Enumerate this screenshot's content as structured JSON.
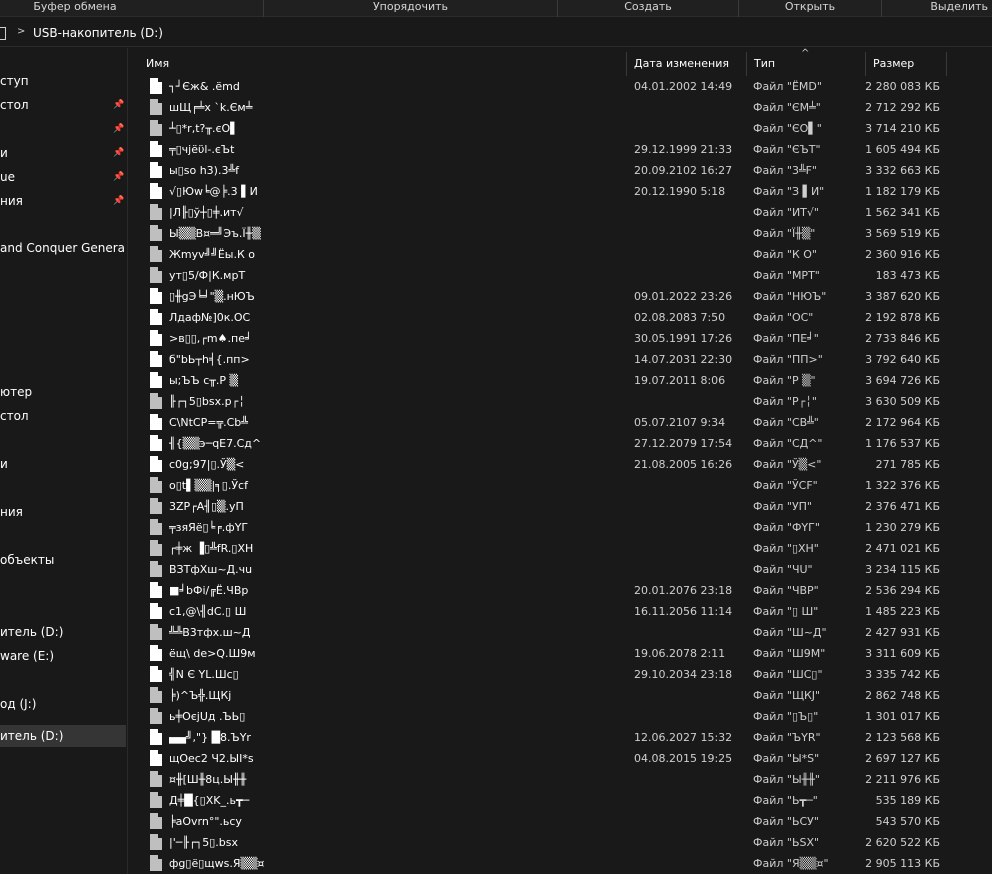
{
  "ribbon": {
    "groups": [
      "Буфер обмена",
      "Упорядочить",
      "Создать",
      "Открыть",
      "Выделить"
    ]
  },
  "address": {
    "path_label": "USB-накопитель (D:)"
  },
  "nav": {
    "items": [
      {
        "label": "ступ",
        "pinned": false
      },
      {
        "label": "стол",
        "pinned": true
      },
      {
        "label": "",
        "pinned": true
      },
      {
        "label": "и",
        "pinned": true
      },
      {
        "label": "ue",
        "pinned": true
      },
      {
        "label": "ния",
        "pinned": true
      },
      {
        "label": "and Conquer Generals Z",
        "pinned": false
      },
      {
        "label": "ютер",
        "pinned": false
      },
      {
        "label": "стол",
        "pinned": false
      },
      {
        "label": "",
        "pinned": false
      },
      {
        "label": "и",
        "pinned": false
      },
      {
        "label": "ния",
        "pinned": false
      },
      {
        "label": "объекты",
        "pinned": false
      },
      {
        "label": "итель (D:)",
        "pinned": false
      },
      {
        "label": "ware (E:)",
        "pinned": false
      },
      {
        "label": "од (J:)",
        "pinned": false
      },
      {
        "label": "итель (D:)",
        "pinned": false,
        "selected": true
      }
    ]
  },
  "columns": {
    "name": "Имя",
    "date": "Дата изменения",
    "type": "Тип",
    "size": "Размер",
    "sort_indicator": "^"
  },
  "files": [
    {
      "name": "┐┘Єж&    .ёmd",
      "date": "04.01.2002 14:49",
      "type": "Файл \"ЁMD\"",
      "size": "2 280 083 КБ"
    },
    {
      "name": "шЩ╒╧х `k.Єм╧",
      "date": "",
      "type": "Файл \"ЄМ╧\"",
      "size": "2 712 292 КБ"
    },
    {
      "name": "┴▯*r,t?╥.єО▌",
      "date": "",
      "type": "Файл \"ЄО▌\"",
      "size": "3 714 210 КБ"
    },
    {
      "name": "╤▯чjёϋl-.єЪt",
      "date": "29.12.1999 21:33",
      "type": "Файл \"ЄЪТ\"",
      "size": "1 605 494 КБ"
    },
    {
      "name": "ы▯so h3).3╩f",
      "date": "20.09.2102 16:27",
      "type": "Файл \"3╩F\"",
      "size": "3 332 663 КБ"
    },
    {
      "name": "√▯Юw╘@╞.3  ▌И",
      "date": "20.12.1990 5:18",
      "type": "Файл \"З  ▌И\"",
      "size": "1 182 179 КБ"
    },
    {
      "name": "|Л╟▯ў┼▯╪.ит√",
      "date": "",
      "type": "Файл \"ИТ√\"",
      "size": "1 562 341 КБ"
    },
    {
      "name": "Ы▒▒B¤═╝Эъ.Ї╫▒",
      "date": "",
      "type": "Файл \"Ї╫▒\"",
      "size": "3 569 519 КБ"
    },
    {
      "name": "Жmyv╝╝Ёы.К о",
      "date": "",
      "type": "Файл \"К О\"",
      "size": "2 360 916 КБ"
    },
    {
      "name": "ут▯5/Ф|К.мрТ",
      "date": "",
      "type": "Файл \"МРТ\"",
      "size": "183 473 КБ"
    },
    {
      "name": "▯╫gЭ╘╛\"▒.нЮЪ",
      "date": "09.01.2022 23:26",
      "type": "Файл \"НЮЪ\"",
      "size": "3 387 620 КБ"
    },
    {
      "name": "Лдаф№]0к.ОС",
      "date": "02.08.2083 7:50",
      "type": "Файл \"ОС\"",
      "size": "2 192 878 КБ"
    },
    {
      "name": ">в▯▯,┌m♠.пе╛",
      "date": "30.05.1991 17:26",
      "type": "Файл \"ПЕ╛\"",
      "size": "2 733 846 КБ"
    },
    {
      "name": "б\"bЬ┬h╡{.пп>",
      "date": "14.07.2031 22:30",
      "type": "Файл \"ПП>\"",
      "size": "3 792 640 КБ"
    },
    {
      "name": "ы;ЪЪ с╥.Р ▒",
      "date": "19.07.2011 8:06",
      "type": "Файл \"Р ▒\"",
      "size": "3 694 726 КБ"
    },
    {
      "name": "╟┌┐5▯bsx.р┌╎",
      "date": "",
      "type": "Файл \"Р┌╎\"",
      "size": "3 630 509 КБ"
    },
    {
      "name": "C\\NtCP=╦.Cb╩",
      "date": "05.07.2107 9:34",
      "type": "Файл \"СВ╩\"",
      "size": "2 172 964 КБ"
    },
    {
      "name": "╢{▒▒э─qE7.Сд^",
      "date": "27.12.2079 17:54",
      "type": "Файл \"СД^\"",
      "size": "1 176 537 КБ"
    },
    {
      "name": "c0g;97|▯.Ў▒<",
      "date": "21.08.2005 16:26",
      "type": "Файл \"Ў▒<\"",
      "size": "271 785 КБ"
    },
    {
      "name": "o▯t▌▒▒|╕▯.Ўcf",
      "date": "",
      "type": "Файл \"ЎCF\"",
      "size": "1 322 376 КБ"
    },
    {
      "name": "3ZP┌A╢▯▒.уП",
      "date": "",
      "type": "Файл \"УП\"",
      "size": "2 376 471 КБ"
    },
    {
      "name": "╤зяЯё▯╘╒.фҮГ",
      "date": "",
      "type": "Файл \"ФҮГ\"",
      "size": "1 230 279 КБ"
    },
    {
      "name": "┌╪ж ▐▯╩fR.▯XH",
      "date": "",
      "type": "Файл \"▯ХН\"",
      "size": "2 471 021 КБ"
    },
    {
      "name": "ВЗТфХш~Д.чu",
      "date": "",
      "type": "Файл \"ЧU\"",
      "size": "3 234 115 КБ"
    },
    {
      "name": "■╛bФi/╔Ё.ЧВр",
      "date": "20.01.2076 23:18",
      "type": "Файл \"ЧВР\"",
      "size": "2 536 294 КБ"
    },
    {
      "name": "c1,@\\╢dC.▯  Ш",
      "date": "16.11.2056 11:14",
      "type": "Файл \"▯  Ш\"",
      "size": "1 485 223 КБ"
    },
    {
      "name": "╩╩В3тфх.ш~Д",
      "date": "",
      "type": "Файл \"Ш~Д\"",
      "size": "2 427 931 КБ"
    },
    {
      "name": "ёщ\\ de>Q.Ш9м",
      "date": "19.06.2078 2:11",
      "type": "Файл \"Ш9М\"",
      "size": "3 311 609 КБ"
    },
    {
      "name": "╣N Є  YL.Шс▯",
      "date": "29.10.2034 23:18",
      "type": "Файл \"ШС▯\"",
      "size": "3 335 742 КБ"
    },
    {
      "name": "╞)^Ъ╬.ЩКj",
      "date": "",
      "type": "Файл \"ЩКJ\"",
      "size": "2 862 748 КБ"
    },
    {
      "name": "ь╪ОєjUд  .ЪЬ▯",
      "date": "",
      "type": "Файл \"▯Ъ▯\"",
      "size": "1 301 017 КБ"
    },
    {
      "name": "▄▄╝,\"}  █8.ЪYr",
      "date": "12.06.2027 15:32",
      "type": "Файл \"ЪYR\"",
      "size": "2 123 568 КБ"
    },
    {
      "name": "щОес2 Ч2.ЫI*s",
      "date": "04.08.2015 19:25",
      "type": "Файл \"Ы*S\"",
      "size": "2 697 127 КБ"
    },
    {
      "name": "¤╫[Ш╫8ц.Ы╫╫",
      "date": "",
      "type": "Файл \"Ы╫╫\"",
      "size": "2 211 976 КБ"
    },
    {
      "name": "Д╪█{▯XK_.ь┳─",
      "date": "",
      "type": "Файл \"Ь┳─\"",
      "size": "535 189 КБ"
    },
    {
      "name": "╞aOvrn°\".ьсу",
      "date": "",
      "type": "Файл \"ЬСУ\"",
      "size": "543 570 КБ"
    },
    {
      "name": "|'─╟┌┐5▯.bsx",
      "date": "",
      "type": "Файл \"ЬSX\"",
      "size": "2 620 522 КБ"
    },
    {
      "name": "фg▯ё▯щws.Я▒▒¤",
      "date": "",
      "type": "Файл \"Я▒▒¤\"",
      "size": "2 905 113 КБ"
    }
  ]
}
